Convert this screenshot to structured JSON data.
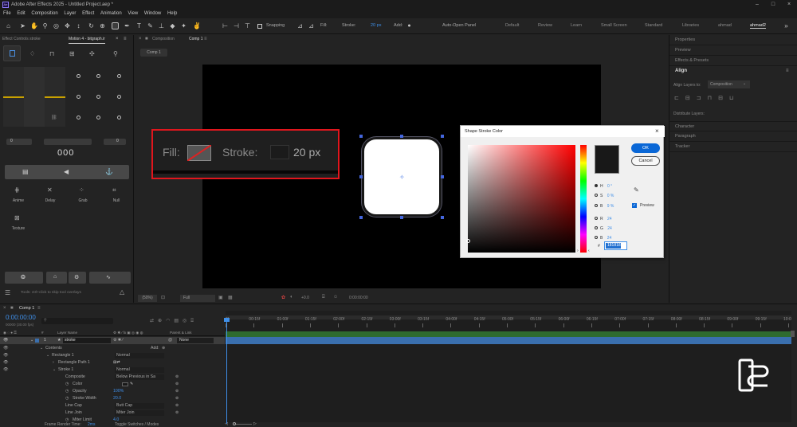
{
  "app": {
    "title": "Adobe After Effects 2025 - Untitled Project.aep *",
    "logo": "Ae"
  },
  "menu": [
    "File",
    "Edit",
    "Composition",
    "Layer",
    "Effect",
    "Animation",
    "View",
    "Window",
    "Help"
  ],
  "toolbar": {
    "snapping_label": "Snapping",
    "fill_label": "Fill:",
    "stroke_label": "Stroke:",
    "stroke_px": "20 px",
    "add_label": "Add:",
    "auto_open_panel": "Auto-Open Panel",
    "workspaces": [
      "Default",
      "Review",
      "Learn",
      "Small Screen",
      "Standard",
      "Libraries",
      "ahmad",
      "ahmad2"
    ],
    "active_workspace": "ahmad2"
  },
  "left_panel": {
    "tab1": "Effect Controls stroke",
    "tab2": "Motion 4 - bitgraph.ir",
    "val_left": "0",
    "val_right": "0",
    "counter": "000",
    "buttons": [
      "Anime",
      "Delay",
      "Grab",
      "Null"
    ],
    "texture": "Texture",
    "tools_hint": "Tools: ctrl+click to skip tool overlays"
  },
  "comp_panel": {
    "tab_label": "Composition",
    "tab_name": "Comp 1",
    "crumb": "Comp 1",
    "zoom": "(50%)",
    "quality": "Full",
    "exposure": "+0.0",
    "time": "0:00:00:00"
  },
  "zoom_callout": {
    "fill": "Fill:",
    "stroke": "Stroke:",
    "px": "20 px"
  },
  "color_dialog": {
    "title": "Shape Stroke Color",
    "ok": "OK",
    "cancel": "Cancel",
    "fields": [
      {
        "k": "H",
        "v": "0 °"
      },
      {
        "k": "S",
        "v": "0 %"
      },
      {
        "k": "B",
        "v": "9 %"
      },
      {
        "k": "R",
        "v": "24"
      },
      {
        "k": "G",
        "v": "24"
      },
      {
        "k": "B",
        "v": "24"
      }
    ],
    "hex_label": "#",
    "hex": "181818",
    "preview": "Preview",
    "preview_checked": true
  },
  "right_panel": {
    "items_top": [
      "Properties",
      "Preview",
      "Effects & Presets"
    ],
    "align_title": "Align",
    "align_to_label": "Align Layers to:",
    "align_to_value": "Composition",
    "distribute": "Distribute Layers:",
    "items_bottom": [
      "Character",
      "Paragraph",
      "Tracker"
    ]
  },
  "timeline": {
    "tab": "Comp 1",
    "timecode": "0:00:00:00",
    "fps": "00000 (30.00 fps)",
    "col_layer_name": "Layer Name",
    "col_parent": "Parent & Link",
    "layer_num": "1",
    "layer_name": "stroke",
    "parent": "None",
    "add_label": "Add:",
    "rows": [
      {
        "label": "Contents",
        "value": ""
      },
      {
        "label": "Rectangle 1",
        "value": "Normal"
      },
      {
        "label": "Rectangle Path 1",
        "value": ""
      },
      {
        "label": "Stroke 1",
        "value": "Normal"
      },
      {
        "label": "Composite",
        "value": "Below Previous in Sa"
      },
      {
        "label": "Color",
        "value": ""
      },
      {
        "label": "Opacity",
        "value": "100%"
      },
      {
        "label": "Stroke Width",
        "value": "20.0"
      },
      {
        "label": "Line Cap",
        "value": "Butt Cap"
      },
      {
        "label": "Line Join",
        "value": "Miter Join"
      },
      {
        "label": "Miter Limit",
        "value": "4.0"
      }
    ],
    "ruler": [
      "0f",
      "00:15f",
      "01:00f",
      "01:15f",
      "02:00f",
      "02:15f",
      "03:00f",
      "03:15f",
      "04:00f",
      "04:15f",
      "05:00f",
      "05:15f",
      "06:00f",
      "06:15f",
      "07:00f",
      "07:15f",
      "08:00f",
      "08:15f",
      "09:00f",
      "09:15f",
      "10:0"
    ],
    "footer_render": "Frame Render Time:",
    "footer_ms": "2ms",
    "footer_toggle": "Toggle Switches / Modes"
  },
  "colors": {
    "accent_blue": "#3f8fe8",
    "highlight_red": "#e0161d",
    "gold": "#c8a000",
    "layer_bar": "#3a6fae"
  }
}
